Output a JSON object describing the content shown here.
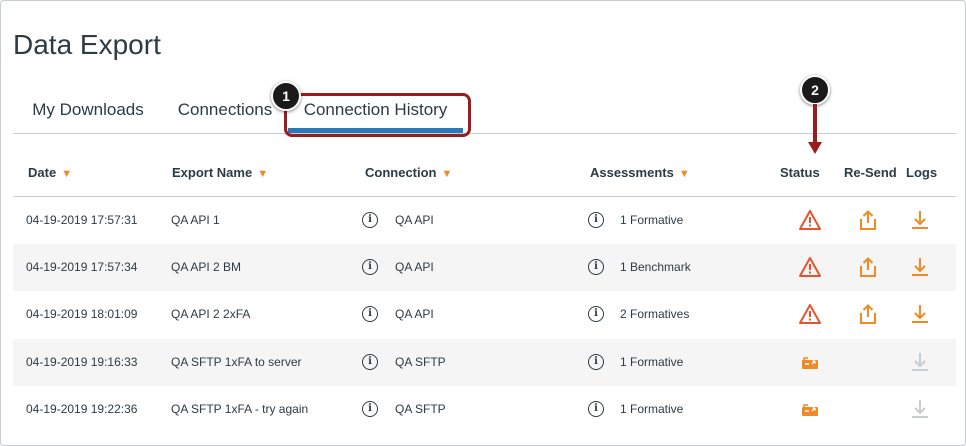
{
  "page": {
    "title": "Data Export"
  },
  "tabs": [
    {
      "label": "My Downloads"
    },
    {
      "label": "Connections"
    },
    {
      "label": "Connection History"
    }
  ],
  "callouts": {
    "one": "1",
    "two": "2"
  },
  "table": {
    "headers": {
      "date": "Date",
      "export_name": "Export Name",
      "connection": "Connection",
      "assessments": "Assessments",
      "status": "Status",
      "resend": "Re-Send",
      "logs": "Logs"
    },
    "info_glyph": "i",
    "rows": [
      {
        "date": "04-19-2019 17:57:31",
        "export_name": "QA API 1",
        "connection": "QA API",
        "assessments": "1 Formative",
        "status": "warning-icon"
      },
      {
        "date": "04-19-2019 17:57:34",
        "export_name": "QA API 2 BM",
        "connection": "QA API",
        "assessments": "1 Benchmark",
        "status": "warning-icon"
      },
      {
        "date": "04-19-2019 18:01:09",
        "export_name": "QA API 2 2xFA",
        "connection": "QA API",
        "assessments": "2 Formatives",
        "status": "warning-icon"
      },
      {
        "date": "04-19-2019 19:16:33",
        "export_name": "QA SFTP 1xFA to server",
        "connection": "QA SFTP",
        "assessments": "1 Formative",
        "status": "sent-icon"
      },
      {
        "date": "04-19-2019 19:22:36",
        "export_name": "QA SFTP 1xFA - try again",
        "connection": "QA SFTP",
        "assessments": "1 Formative",
        "status": "sent-icon"
      }
    ]
  },
  "colors": {
    "accent_orange": "#f08a24",
    "warning_red": "#e8532b",
    "active_tab": "#2c79b8",
    "callout_red": "#9b1c1c",
    "disabled_gray": "#c7cdd1"
  }
}
